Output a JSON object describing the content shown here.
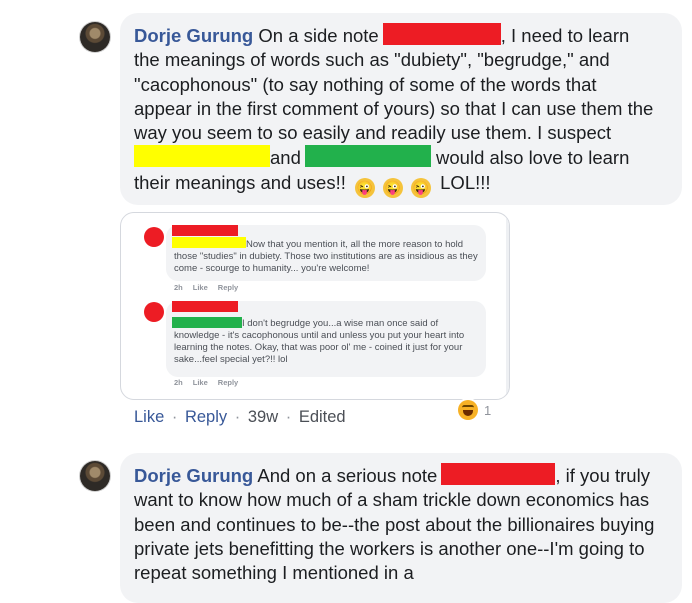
{
  "comments": [
    {
      "author": "Dorje Gurung",
      "text_1": "On a side note",
      "text_2": ", I need to learn the meanings of words such as \"dubiety\", \"begrudge,\" and \"cacophonous\" (to say nothing of some of the words that appear in the first comment of yours) so that I can use them the way you seem to so easily and readily use them. I suspect",
      "text_3": "and",
      "text_4": "would also love to learn their meanings and uses!!",
      "text_5": "LOL!!!",
      "emoji_name": "winking-face-with-tongue-icon"
    },
    {
      "author": "Dorje Gurung",
      "text_1": "And on a serious note",
      "text_2": ", if you truly want to know how much of a sham trickle down economics has been and continues to be--the post about the billionaires buying private jets benefitting the workers is another one--I'm going to repeat something I mentioned in a"
    }
  ],
  "embedded": {
    "reply_1": {
      "text": "Now that you mention it, all the more reason to hold those \"studies\" in dubiety. Those two institutions are as insidious as they come - scourge to humanity... you're welcome!",
      "time": "2h",
      "like": "Like",
      "reply": "Reply"
    },
    "reply_2": {
      "text": "I don't begrudge you...a wise man once said of knowledge - it's cacophonous until and unless you put your heart into learning the notes. Okay, that was poor ol' me - coined it just for your sake...feel special yet?!! lol",
      "time": "2h",
      "like": "Like",
      "reply": "Reply"
    }
  },
  "actions": {
    "like": "Like",
    "reply": "Reply",
    "time": "39w",
    "edited": "Edited",
    "sep": "·"
  },
  "reaction": {
    "icon": "haha-reaction-icon",
    "count": "1"
  },
  "colors": {
    "redact_red": "#ed1c24",
    "redact_yellow": "#ffff00",
    "redact_green": "#22b14c",
    "link_blue": "#385898",
    "bubble_gray": "#f2f3f5"
  }
}
